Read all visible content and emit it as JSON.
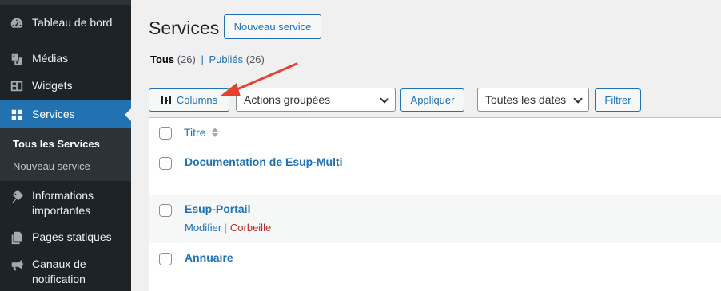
{
  "sidebar": {
    "items": [
      {
        "label": "Tableau de bord",
        "icon": "dashboard-icon"
      },
      {
        "label": "Médias",
        "icon": "media-icon"
      },
      {
        "label": "Widgets",
        "icon": "widgets-icon"
      },
      {
        "label": "Services",
        "icon": "grid-icon"
      },
      {
        "label_line1": "Informations",
        "label_line2": "importantes",
        "icon": "tag-icon"
      },
      {
        "label": "Pages statiques",
        "icon": "pages-icon"
      },
      {
        "label_line1": "Canaux de",
        "label_line2": "notification",
        "icon": "megaphone-icon"
      }
    ],
    "submenu": [
      {
        "label": "Tous les Services"
      },
      {
        "label": "Nouveau service"
      }
    ]
  },
  "header": {
    "title": "Services",
    "new_button": "Nouveau service"
  },
  "filters": {
    "all_label": "Tous",
    "all_count": "(26)",
    "separator": "|",
    "published_label": "Publiés",
    "published_count": "(26)"
  },
  "toolbar": {
    "columns_button": "Columns",
    "bulk_actions": "Actions groupées",
    "apply_button": "Appliquer",
    "dates": "Toutes les dates",
    "filter_button": "Filtrer"
  },
  "table": {
    "header_title": "Titre",
    "rows": [
      {
        "title": "Documentation de Esup-Multi"
      },
      {
        "title": "Esup-Portail",
        "action_edit": "Modifier",
        "action_sep": "|",
        "action_trash": "Corbeille"
      },
      {
        "title": "Annuaire"
      }
    ]
  },
  "colors": {
    "accent": "#2271b1",
    "sidebar_bg": "#1d2327",
    "annotation_arrow": "#e8402f",
    "trash": "#b32d2e"
  }
}
